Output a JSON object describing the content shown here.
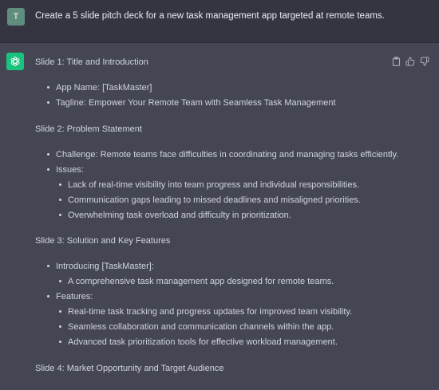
{
  "user": {
    "avatar_initial": "T",
    "message": "Create a 5 slide pitch deck for a new task management app targeted at remote teams."
  },
  "assistant": {
    "actions": {
      "copy_icon": "clipboard-icon",
      "like_icon": "thumbs-up-icon",
      "dislike_icon": "thumbs-down-icon"
    },
    "slide1": {
      "heading": "Slide 1: Title and Introduction",
      "items": [
        "App Name: [TaskMaster]",
        "Tagline: Empower Your Remote Team with Seamless Task Management"
      ]
    },
    "slide2": {
      "heading": "Slide 2: Problem Statement",
      "challenge": "Challenge: Remote teams face difficulties in coordinating and managing tasks efficiently.",
      "issues_label": "Issues:",
      "issues": [
        "Lack of real-time visibility into team progress and individual responsibilities.",
        "Communication gaps leading to missed deadlines and misaligned priorities.",
        "Overwhelming task overload and difficulty in prioritization."
      ]
    },
    "slide3": {
      "heading": "Slide 3: Solution and Key Features",
      "introducing_label": "Introducing [TaskMaster]:",
      "introducing": [
        "A comprehensive task management app designed for remote teams."
      ],
      "features_label": "Features:",
      "features": [
        "Real-time task tracking and progress updates for improved team visibility.",
        "Seamless collaboration and communication channels within the app.",
        "Advanced task prioritization tools for effective workload management."
      ]
    },
    "slide4": {
      "heading": "Slide 4: Market Opportunity and Target Audience"
    }
  },
  "colors": {
    "user_bg": "#343541",
    "assistant_bg": "#444654",
    "bot_avatar": "#19c37d",
    "user_avatar": "#5f8e7f",
    "text": "#d1d5db"
  }
}
